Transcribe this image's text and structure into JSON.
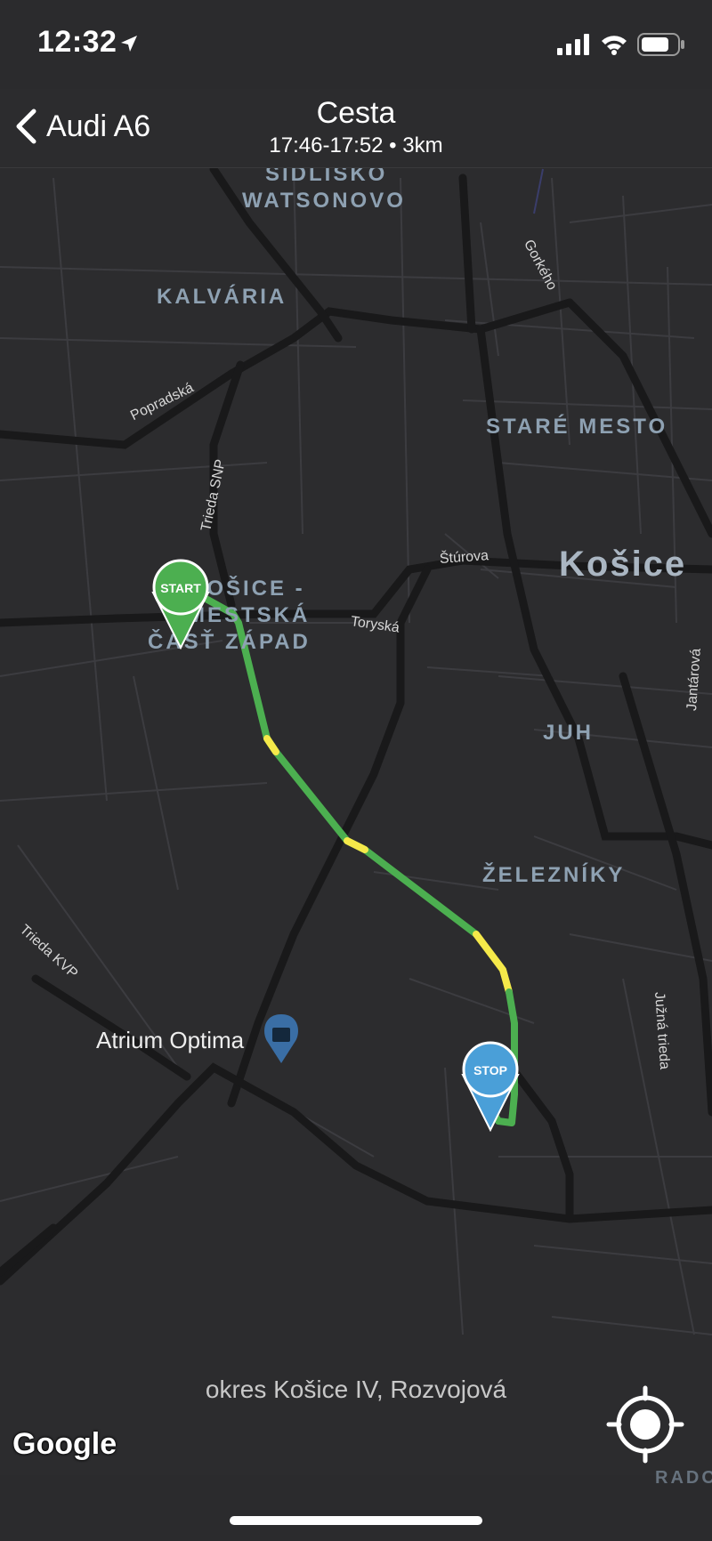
{
  "status_bar": {
    "time": "12:32"
  },
  "header": {
    "back_label": "Audi A6",
    "title": "Cesta",
    "subtitle": "17:46-17:52 • 3km"
  },
  "map": {
    "districts": {
      "sidlisko_1": "SIDLISKO",
      "sidlisko_2": "WATSONOVO",
      "kalvaria": "KALVÁRIA",
      "stare_mesto": "STARÉ MESTO",
      "zapad_1": "KOŠICE -",
      "zapad_2": "MESTSKÁ",
      "zapad_3": "ČASŤ ZÁPAD",
      "juh": "JUH",
      "zelezniky": "ŽELEZNÍKY"
    },
    "city": "Košice",
    "streets": {
      "gorkeho": "Gorkého",
      "popradska": "Popradská",
      "trieda_snp": "Trieda SNP",
      "sturova": "Štúrova",
      "toryska": "Toryská",
      "jantarova": "Jantárová",
      "trieda_kvp": "Trieda KVP",
      "juzna_trieda": "Južná trieda",
      "rozvojova_partial": "Rozvojová"
    },
    "poi": {
      "name": "Atrium Optima",
      "icon": "shopping-bag-icon"
    },
    "start_marker": {
      "label": "START",
      "color": "#4caf50"
    },
    "stop_marker": {
      "label": "STOP",
      "color": "#4a9fd8"
    },
    "route_colors": {
      "normal": "#4caf50",
      "slow": "#f5e94a"
    },
    "attribution": "Google",
    "bottom_partial": "RADO"
  },
  "address": "okres Košice IV, Rozvojová"
}
